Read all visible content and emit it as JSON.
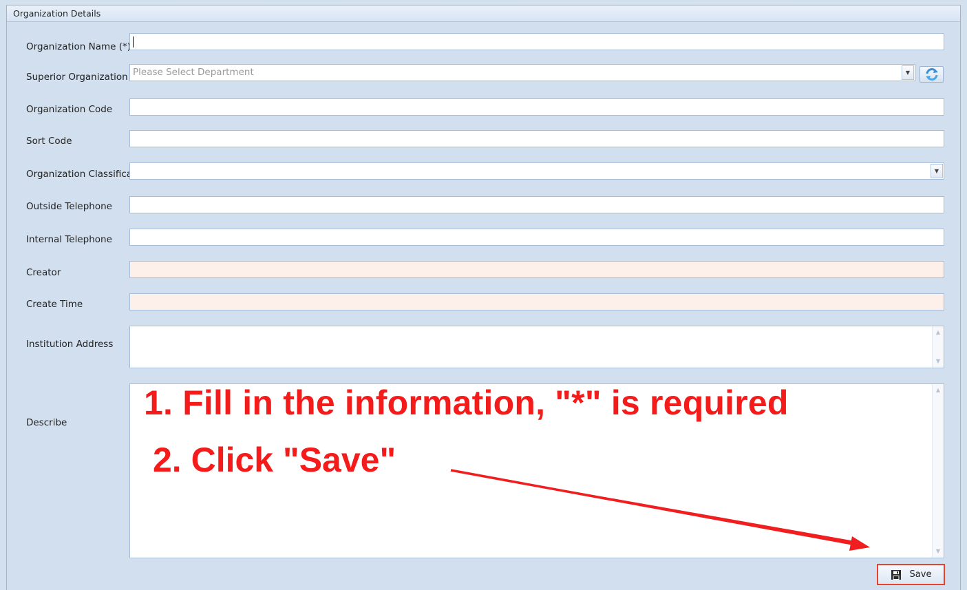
{
  "group": {
    "title": "Organization Details"
  },
  "fields": {
    "org_name": {
      "label": "Organization Name (*)",
      "value": ""
    },
    "superior": {
      "label": "Superior Organization",
      "placeholder": "Please Select Department"
    },
    "org_code": {
      "label": "Organization Code",
      "value": ""
    },
    "sort_code": {
      "label": "Sort Code",
      "value": ""
    },
    "classification": {
      "label": "Organization Classification",
      "value": ""
    },
    "outside_tel": {
      "label": "Outside Telephone",
      "value": ""
    },
    "internal_tel": {
      "label": "Internal Telephone",
      "value": ""
    },
    "creator": {
      "label": "Creator",
      "value": ""
    },
    "create_time": {
      "label": "Create Time",
      "value": ""
    },
    "address": {
      "label": "Institution Address",
      "value": ""
    },
    "describe": {
      "label": "Describe",
      "value": ""
    }
  },
  "annotations": {
    "step1": "1. Fill in the information, \"*\" is required",
    "step2": "2. Click \"Save\""
  },
  "toolbar": {
    "save_label": "Save"
  },
  "colors": {
    "annotation": "#f41b1b",
    "highlight_border": "#e8412c",
    "readonly_bg": "#fdf0eb"
  },
  "icons": [
    "dropdown-arrow-icon",
    "refresh-icon",
    "scroll-up-icon",
    "scroll-down-icon",
    "floppy-disk-icon"
  ]
}
